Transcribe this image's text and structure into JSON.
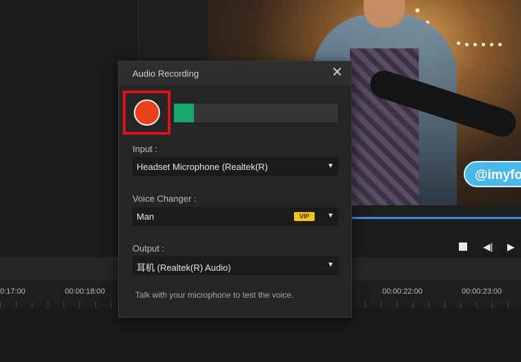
{
  "dialog": {
    "title": "Audio Recording",
    "close_glyph": "✕",
    "level_fraction": 0.12,
    "input": {
      "label": "Input :",
      "value": "Headset Microphone (Realtek(R)"
    },
    "voice_changer": {
      "label": "Voice Changer :",
      "value": "Man",
      "badge": "VIP"
    },
    "output": {
      "label": "Output :",
      "value": "耳机 (Realtek(R) Audio)"
    },
    "dropdown_glyph": "▼",
    "hint": "Talk with your microphone to test the voice."
  },
  "preview": {
    "watermark": "@imyfo"
  },
  "player": {
    "prev_frame_glyph": "◀|",
    "play_glyph": "▶"
  },
  "timeline": {
    "ticks": [
      "0:17:00",
      "00:00:18:00",
      "00:00:22:00",
      "00:00:23:00"
    ]
  },
  "colors": {
    "record": "#e8411c",
    "highlight": "#e0101a",
    "level": "#19a86b",
    "vip": "#f3c21b",
    "progress": "#3b8fe0"
  }
}
